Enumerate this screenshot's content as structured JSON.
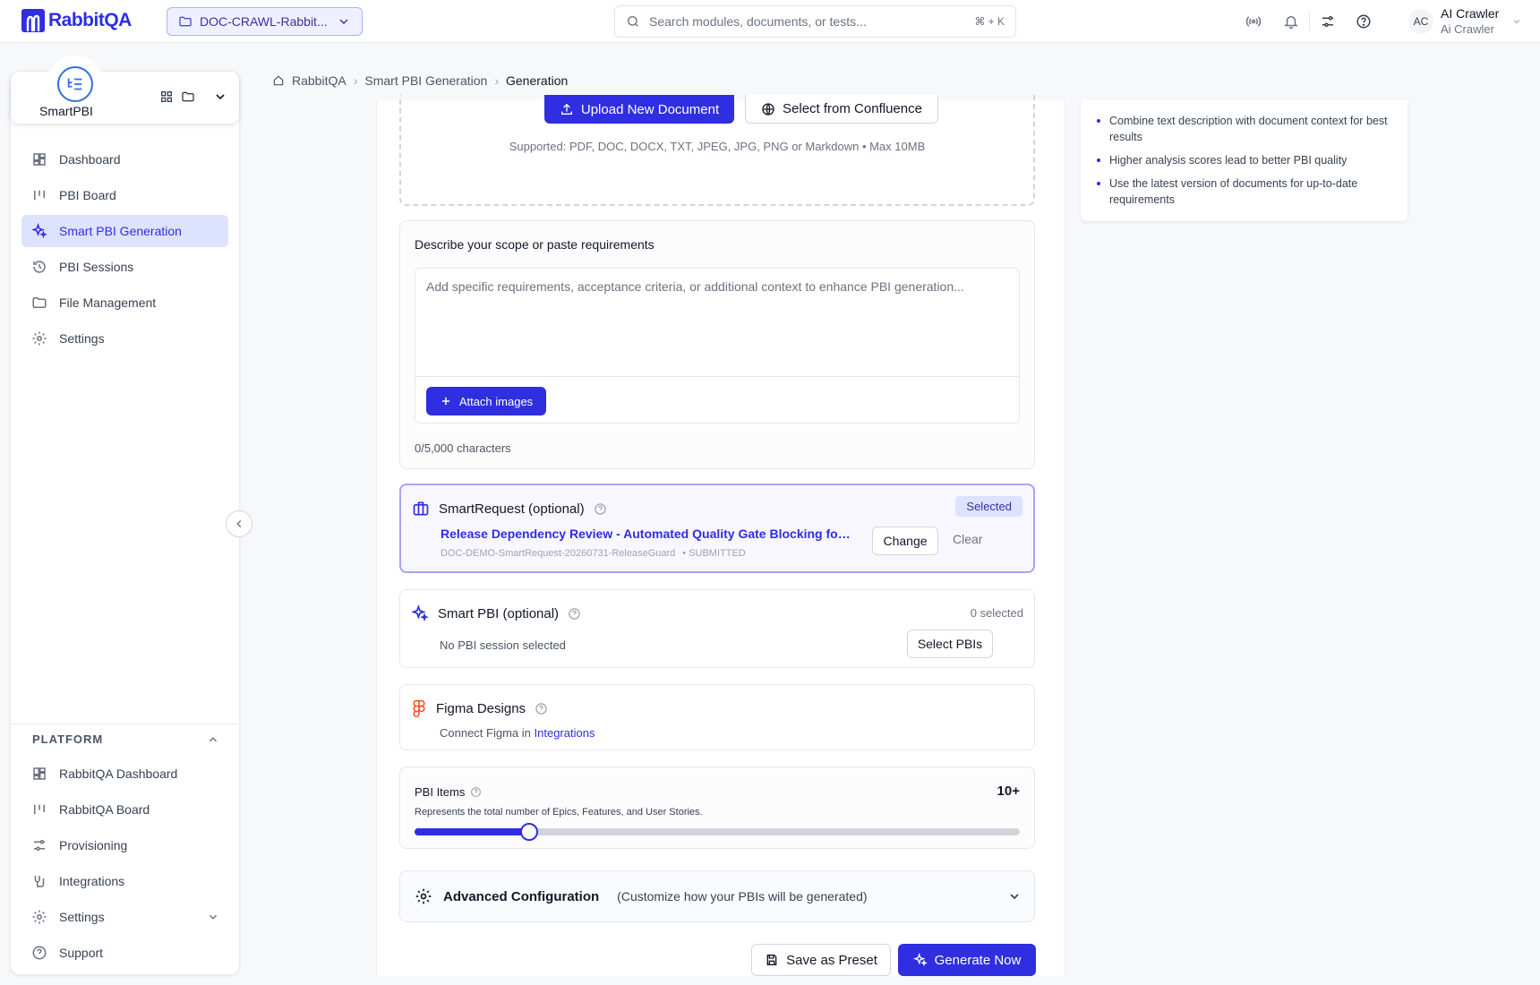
{
  "brand": {
    "name": "RabbitQA"
  },
  "project_selector": {
    "label": "DOC-CRAWL-Rabbit..."
  },
  "search": {
    "placeholder": "Search modules, documents, or tests...",
    "shortcut": "⌘ + K"
  },
  "user": {
    "initials": "AC",
    "name": "AI Crawler",
    "subtitle": "Ai Crawler"
  },
  "app": {
    "name": "SmartPBI"
  },
  "nav": {
    "items": [
      {
        "label": "Dashboard",
        "icon": "dashboard-icon"
      },
      {
        "label": "PBI Board",
        "icon": "board-icon"
      },
      {
        "label": "Smart PBI Generation",
        "icon": "sparkle-icon",
        "active": true
      },
      {
        "label": "PBI Sessions",
        "icon": "history-icon"
      },
      {
        "label": "File Management",
        "icon": "folder-icon"
      },
      {
        "label": "Settings",
        "icon": "gear-icon"
      }
    ]
  },
  "platform": {
    "heading": "PLATFORM",
    "items": [
      {
        "label": "RabbitQA Dashboard",
        "icon": "dashboard-icon"
      },
      {
        "label": "RabbitQA Board",
        "icon": "board-icon"
      },
      {
        "label": "Provisioning",
        "icon": "sliders-icon"
      },
      {
        "label": "Integrations",
        "icon": "plug-icon"
      },
      {
        "label": "Settings",
        "icon": "gear-icon"
      },
      {
        "label": "Support",
        "icon": "help-icon"
      }
    ]
  },
  "breadcrumb": {
    "root": "RabbitQA",
    "parent": "Smart PBI Generation",
    "current": "Generation"
  },
  "upload": {
    "upload_label": "Upload New Document",
    "confluence_label": "Select from Confluence",
    "supported": "Supported: PDF, DOC, DOCX, TXT, JPEG, JPG, PNG or Markdown • Max 10MB"
  },
  "scope": {
    "title": "Describe your scope or paste requirements",
    "placeholder": "Add specific requirements, acceptance criteria, or additional context to enhance PBI generation...",
    "value": "",
    "attach_label": "Attach images",
    "char_count": "0/5,000 characters"
  },
  "smart_request": {
    "title": "SmartRequest (optional)",
    "badge": "Selected",
    "link": "Release Dependency Review - Automated Quality Gate Blocking for Rel...",
    "id": "DOC-DEMO-SmartRequest-20260731-ReleaseGuard",
    "status": "• SUBMITTED",
    "change_label": "Change",
    "clear_label": "Clear"
  },
  "smart_pbi": {
    "title": "Smart PBI (optional)",
    "count": "0 selected",
    "empty": "No PBI session selected",
    "select_label": "Select PBIs"
  },
  "figma": {
    "title": "Figma Designs",
    "prefix": "Connect Figma in",
    "link": "Integrations"
  },
  "pbi_items": {
    "label": "PBI Items",
    "value": "10+",
    "description": "Represents the total number of Epics, Features, and User Stories.",
    "slider_fraction": 0.19
  },
  "advanced": {
    "title": "Advanced Configuration",
    "subtitle": "(Customize how your PBIs will be generated)"
  },
  "actions": {
    "save_preset": "Save as Preset",
    "generate": "Generate Now"
  },
  "tips": [
    "Combine text description with document context for best results",
    "Higher analysis scores lead to better PBI quality",
    "Use the latest version of documents for up-to-date requirements"
  ],
  "colors": {
    "accent": "#2f2ee0",
    "accent_light": "#dde2ff",
    "border": "#e5e7eb"
  }
}
